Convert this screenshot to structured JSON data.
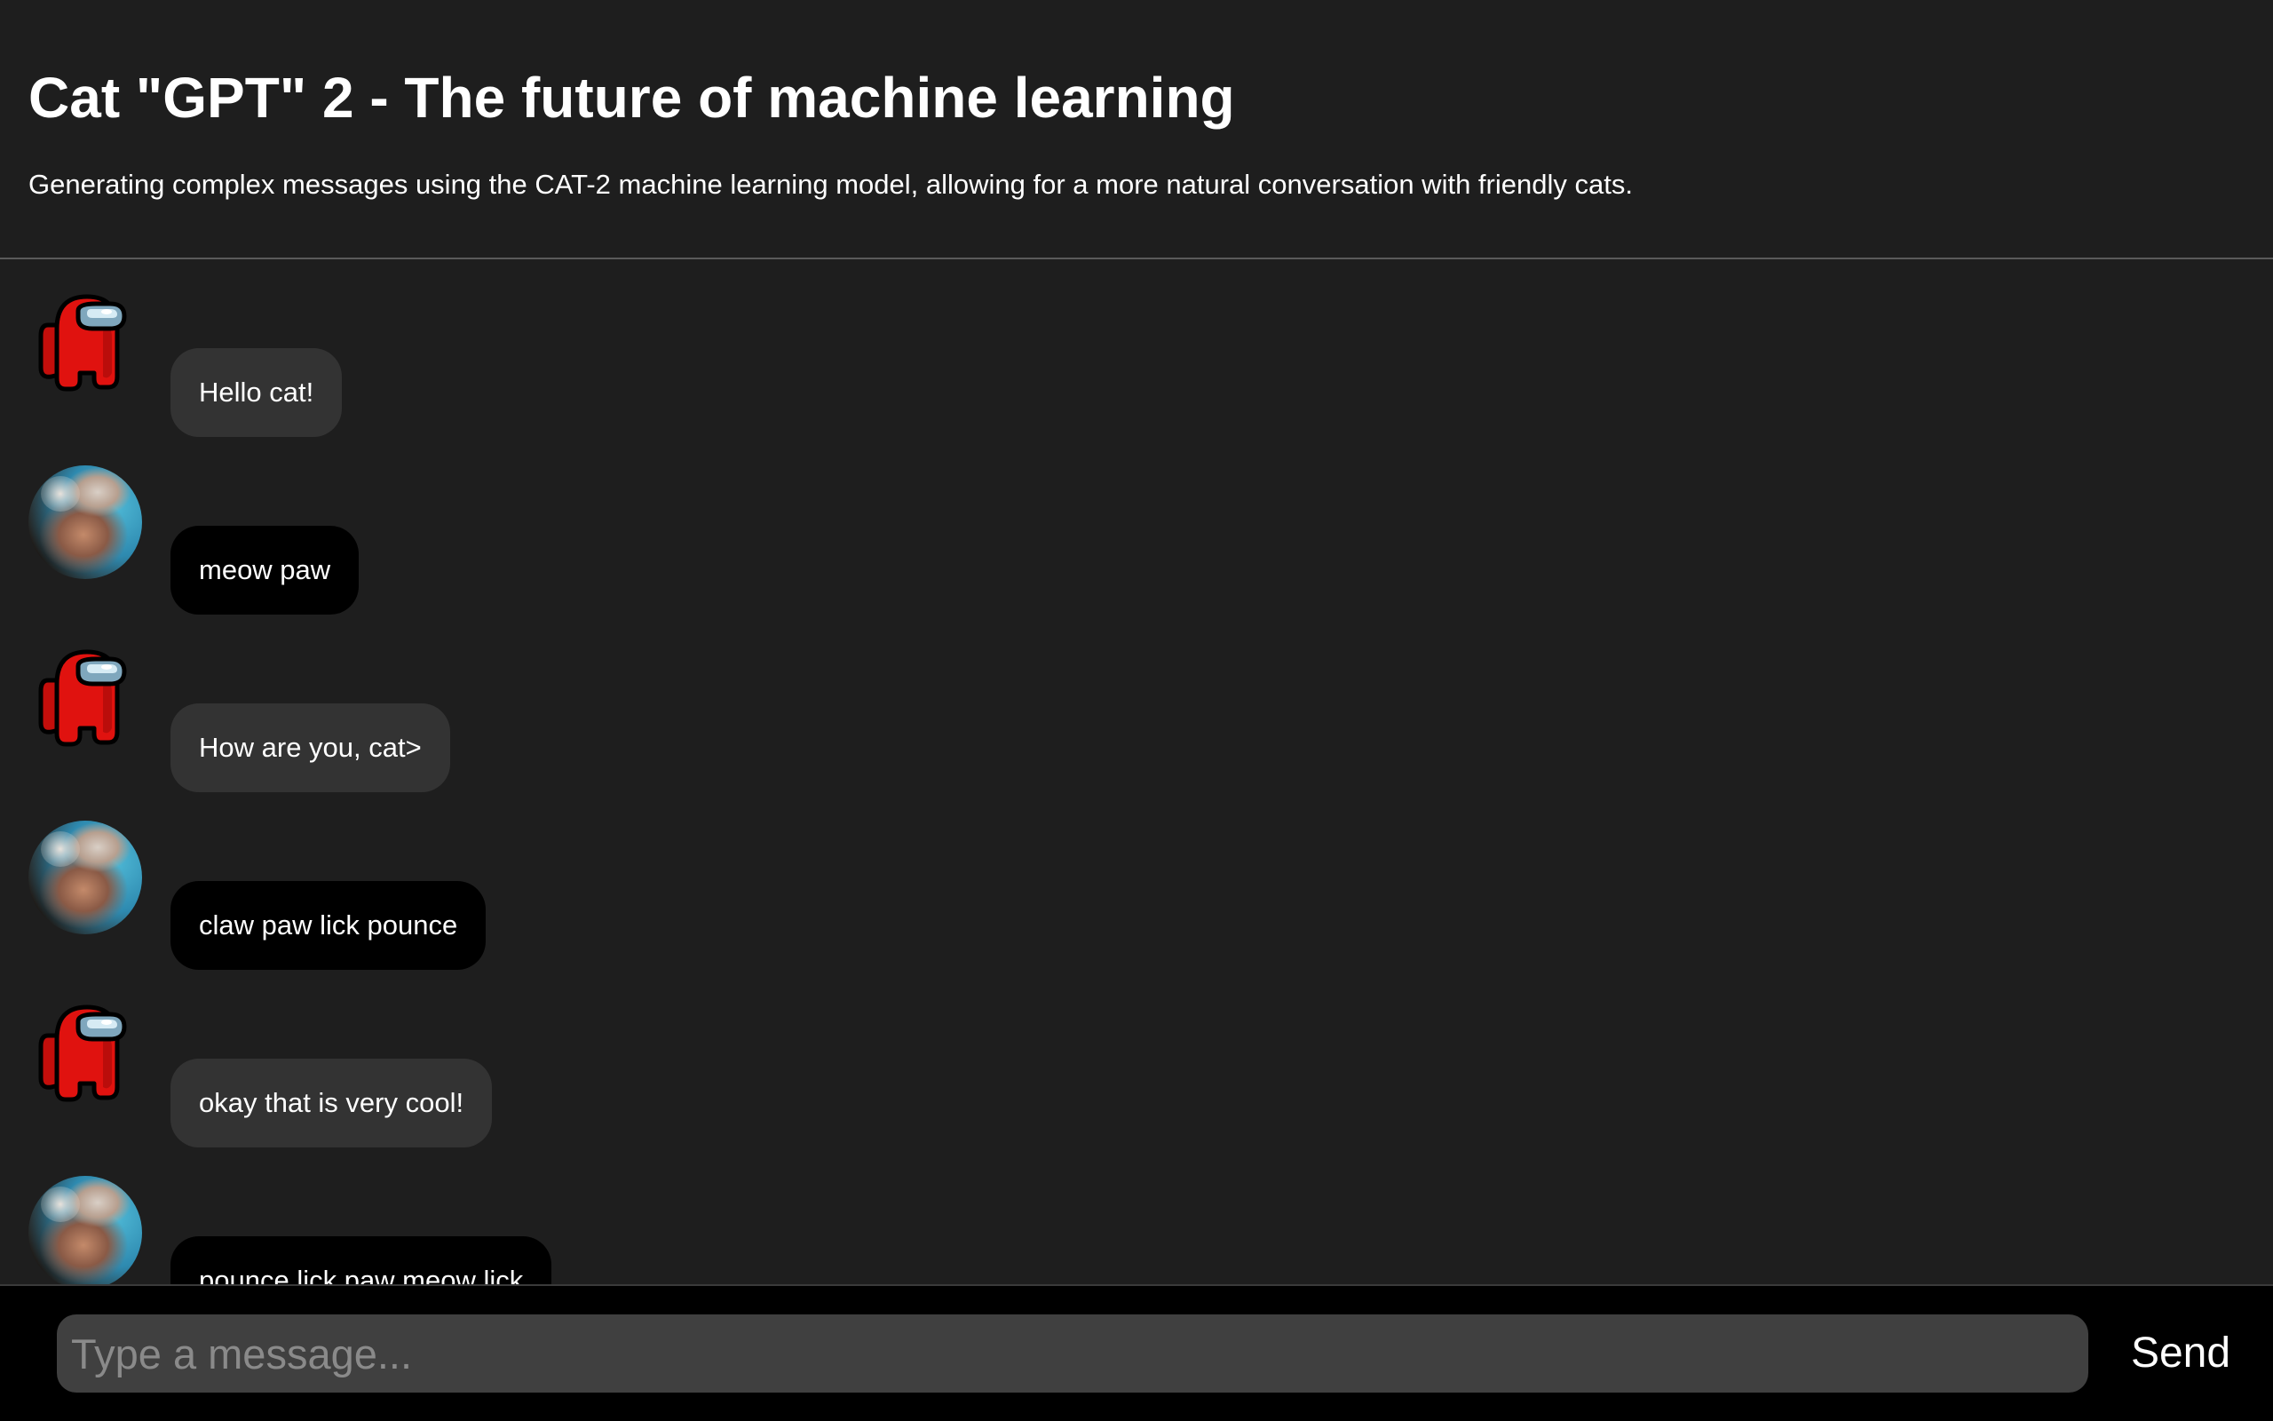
{
  "header": {
    "title": "Cat \"GPT\" 2 - The future of machine learning",
    "subtitle": "Generating complex messages using the CAT-2 machine learning model, allowing for a more natural conversation with friendly cats."
  },
  "messages": [
    {
      "sender": "user",
      "avatar": "red-crewmate-avatar",
      "text": "Hello cat!"
    },
    {
      "sender": "cat",
      "avatar": "cat-photo-avatar",
      "text": "meow paw"
    },
    {
      "sender": "user",
      "avatar": "red-crewmate-avatar",
      "text": "How are you, cat>"
    },
    {
      "sender": "cat",
      "avatar": "cat-photo-avatar",
      "text": "claw paw lick pounce"
    },
    {
      "sender": "user",
      "avatar": "red-crewmate-avatar",
      "text": "okay that is very cool!"
    },
    {
      "sender": "cat",
      "avatar": "cat-photo-avatar",
      "text": "pounce lick paw meow lick"
    }
  ],
  "composer": {
    "placeholder": "Type a message...",
    "value": "",
    "send_label": "Send"
  },
  "colors": {
    "background": "#1e1e1e",
    "user_bubble": "#333333",
    "cat_bubble": "#000000",
    "input_bar": "#000000",
    "input_field": "#404040",
    "crewmate_red": "#e0120f",
    "visor": "#9cc3d9"
  }
}
